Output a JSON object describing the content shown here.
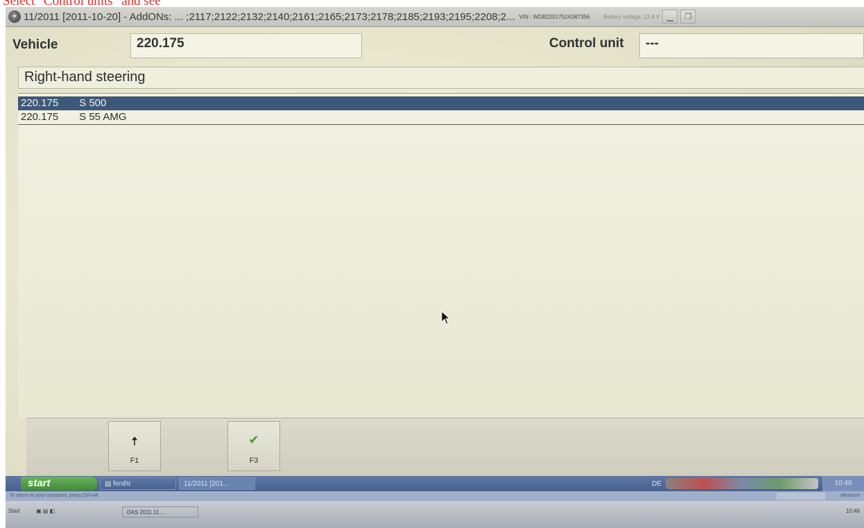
{
  "caption": "Select \"Control units\" and see",
  "window": {
    "title": "11/2011 [2011-10-20] - AddONs: ... ;2117;2122;2132;2140;2161;2165;2173;2178;2185;2193;2195;2208;2...",
    "vin": "VIN : WDB2201752A387356",
    "battery": "Battery voltage: 12.4 V"
  },
  "header": {
    "vehicle_label": "Vehicle",
    "vehicle_value": "220.175",
    "control_unit_label": "Control unit",
    "control_unit_value": "---"
  },
  "steering": "Right-hand steering",
  "models": [
    {
      "code": "220.175",
      "name": "S 500",
      "selected": true
    },
    {
      "code": "220.175",
      "name": "S 55 AMG",
      "selected": false
    }
  ],
  "fkeys": [
    {
      "glyph": "🠅",
      "key": "F1"
    },
    {
      "glyph": "✔",
      "key": "F3"
    }
  ],
  "taskbar": {
    "start": "start",
    "task1": "▤ fenêtr",
    "task2": "11/2011 [201...",
    "clock": "10:46",
    "lang": "DE"
  },
  "status_strip": {
    "left": "To return to your computer, press Ctrl+Alt",
    "right": "Minimize"
  },
  "taskbar2": {
    "start": "Start",
    "task": "DAS 2011.11 ...",
    "tray": "10:46"
  },
  "colors": {
    "selection": "#3d5878",
    "check": "#4a9a2e"
  }
}
